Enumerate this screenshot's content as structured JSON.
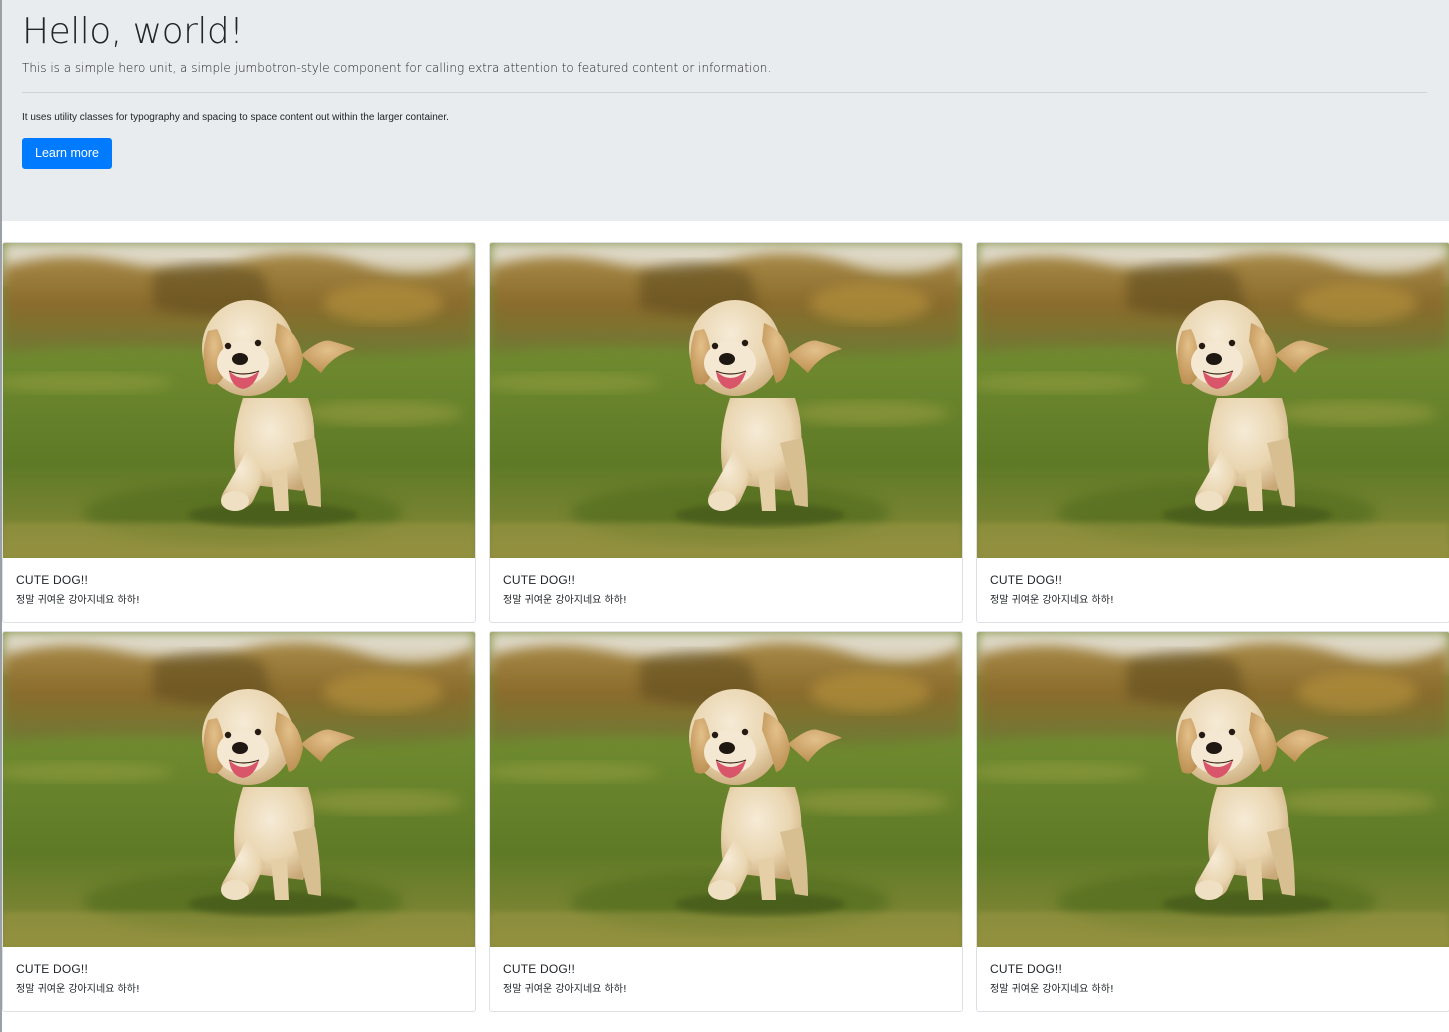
{
  "jumbotron": {
    "title": "Hello, world!",
    "lead": "This is a simple hero unit, a simple jumbotron-style component for calling extra attention to featured content or information.",
    "text": "It uses utility classes for typography and spacing to space content out within the larger container.",
    "button_label": "Learn more"
  },
  "colors": {
    "jumbotron_bg": "#e9ecef",
    "primary": "#007bff",
    "card_border": "#dcdfe3"
  },
  "cards": [
    {
      "image": "puppy-running-on-grass",
      "title": "CUTE DOG!!",
      "text": "정말 귀여운 강아지네요 하하!"
    },
    {
      "image": "puppy-running-on-grass",
      "title": "CUTE DOG!!",
      "text": "정말 귀여운 강아지네요 하하!"
    },
    {
      "image": "puppy-running-on-grass",
      "title": "CUTE DOG!!",
      "text": "정말 귀여운 강아지네요 하하!"
    },
    {
      "image": "puppy-running-on-grass",
      "title": "CUTE DOG!!",
      "text": "정말 귀여운 강아지네요 하하!"
    },
    {
      "image": "puppy-running-on-grass",
      "title": "CUTE DOG!!",
      "text": "정말 귀여운 강아지네요 하하!"
    },
    {
      "image": "puppy-running-on-grass",
      "title": "CUTE DOG!!",
      "text": "정말 귀여운 강아지네요 하하!"
    }
  ]
}
